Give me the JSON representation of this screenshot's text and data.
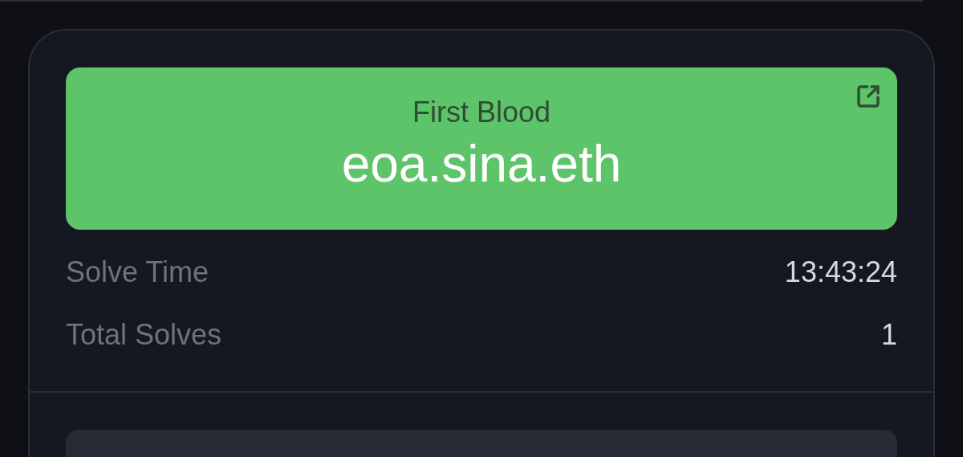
{
  "first_blood": {
    "label": "First Blood",
    "name": "eoa.sina.eth"
  },
  "stats": [
    {
      "label": "Solve Time",
      "value": "13:43:24"
    },
    {
      "label": "Total Solves",
      "value": "1"
    }
  ]
}
